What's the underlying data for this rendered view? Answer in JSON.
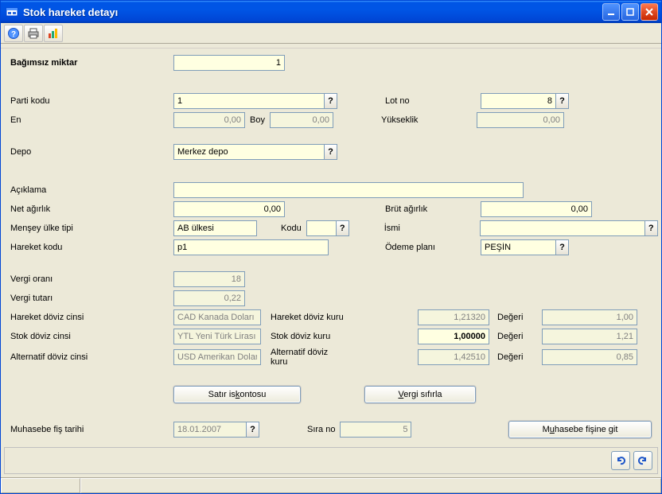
{
  "window": {
    "title": "Stok hareket detayı"
  },
  "toolbar": {
    "icons": [
      "help-icon",
      "print-icon",
      "chart-icon"
    ]
  },
  "labels": {
    "bagimsiz_miktar": "Bağımsız miktar",
    "parti_kodu": "Parti kodu",
    "lot_no": "Lot no",
    "en": "En",
    "boy": "Boy",
    "yukseklik": "Yükseklik",
    "depo": "Depo",
    "aciklama": "Açıklama",
    "net_agirlik": "Net ağırlık",
    "brut_agirlik": "Brüt ağırlık",
    "mensey_ulke_tipi": "Menşey ülke tipi",
    "kodu": "Kodu",
    "ismi": "İsmi",
    "hareket_kodu": "Hareket kodu",
    "odeme_plani": "Ödeme planı",
    "vergi_orani": "Vergi oranı",
    "vergi_tutari": "Vergi tutarı",
    "hareket_doviz_cinsi": "Hareket döviz cinsi",
    "hareket_doviz_kuru": "Hareket döviz kuru",
    "degeri": "Değeri",
    "stok_doviz_cinsi": "Stok döviz cinsi",
    "stok_doviz_kuru": "Stok döviz kuru",
    "alternatif_doviz_cinsi": "Alternatif döviz cinsi",
    "alternatif_doviz_kuru": "Alternatif döviz kuru",
    "muhasebe_fis_tarihi": "Muhasebe fiş tarihi",
    "sira_no": "Sıra no"
  },
  "values": {
    "bagimsiz_miktar": "1",
    "parti_kodu": "1",
    "lot_no": "8",
    "en": "0,00",
    "boy": "0,00",
    "yukseklik": "0,00",
    "depo": "Merkez depo",
    "aciklama": "",
    "net_agirlik": "0,00",
    "brut_agirlik": "0,00",
    "mensey_ulke_tipi": "AB ülkesi",
    "mensey_kodu": "",
    "ismi": "",
    "hareket_kodu": "p1",
    "odeme_plani": "PEŞİN",
    "vergi_orani": "18",
    "vergi_tutari": "0,22",
    "hareket_doviz_cinsi": "CAD Kanada Doları",
    "hareket_doviz_kuru": "1,21320",
    "hareket_degeri": "1,00",
    "stok_doviz_cinsi": "YTL Yeni Türk Lirası",
    "stok_doviz_kuru": "1,00000",
    "stok_degeri": "1,21",
    "alternatif_doviz_cinsi": "USD Amerikan Doları",
    "alternatif_doviz_kuru": "1,42510",
    "alternatif_degeri": "0,85",
    "muhasebe_fis_tarihi": "18.01.2007",
    "sira_no": "5"
  },
  "buttons": {
    "satir_iskontosu_pre": "Satır is",
    "satir_iskontosu_u": "k",
    "satir_iskontosu_post": "ontosu",
    "vergi_sifirla_u": "V",
    "vergi_sifirla_post": "ergi sıfırla",
    "muhasebe_fisine_git_pre": "M",
    "muhasebe_fisine_git_u": "u",
    "muhasebe_fisine_git_post": "hasebe fişine git"
  },
  "helpChar": "?"
}
